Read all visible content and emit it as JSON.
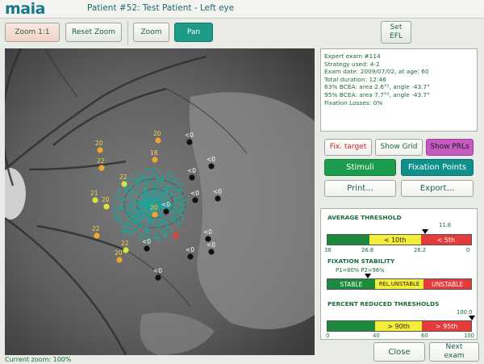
{
  "app": {
    "logo": "maia",
    "title": "Patient #52: Test Patient - Left eye"
  },
  "toolbar": {
    "zoom11": "Zoom 1:1",
    "reset_zoom": "Reset Zoom",
    "zoom": "Zoom",
    "pan": "Pan",
    "set_efl_1": "Set",
    "set_efl_2": "EFL"
  },
  "exam": {
    "line1": "Expert exam #114",
    "line2": "Strategy used: 4-2",
    "line3": "Exam date: 2009/07/02, at age: 60",
    "line4": "Total duration: 12:46",
    "line5": "63% BCEA: area 2.6°², angle -43.7°",
    "line6": "95% BCEA: area 7.7°², angle -43.7°",
    "line7": "Fixation Losses: 0%"
  },
  "controls": {
    "fix_target": "Fix. target",
    "show_grid": "Show Grid",
    "show_prls": "Show PRLs",
    "stimuli": "Stimuli",
    "fixation_points": "Fixation Points",
    "print": "Print...",
    "export": "Export..."
  },
  "threshold": {
    "title": "AVERAGE THRESHOLD",
    "value_label": "11.6",
    "value": 11.6,
    "seg1": "",
    "seg2": "< 10th",
    "seg3": "< 5th",
    "t36": "36",
    "t268": "26.8",
    "t262": "26.2",
    "t0": "0"
  },
  "stability": {
    "title": "FIXATION STABILITY",
    "p_text": "P1=80% P2=96%",
    "stable": "STABLE",
    "rel_unstable": "REL.UNSTABLE",
    "unstable": "UNSTABLE"
  },
  "reduced": {
    "title": "PERCENT REDUCED THRESHOLDS",
    "value_label": "100.0",
    "value": 100.0,
    "seg1": "",
    "seg2": "> 90th",
    "seg3": "> 95th",
    "t0": "0",
    "t40": "40",
    "t60": "60",
    "t100": "100"
  },
  "footer": {
    "close": "Close",
    "next1": "Next",
    "next2": "exam",
    "zoom_status": "Current zoom: 100%"
  },
  "colors": {
    "accent": "#1d9b86",
    "stable": "#1c8a3a",
    "warning": "#f4ee3a",
    "danger": "#e63b3b"
  },
  "stimuli_labels": [
    {
      "t": "20",
      "c": "orange"
    },
    {
      "t": "20",
      "c": "orange"
    },
    {
      "t": "<0",
      "c": "black"
    },
    {
      "t": "22",
      "c": "orange"
    },
    {
      "t": "18",
      "c": "orange"
    },
    {
      "t": "<0",
      "c": "black"
    },
    {
      "t": "22",
      "c": "yellow"
    },
    {
      "t": "<0",
      "c": "black"
    },
    {
      "t": "21",
      "c": "yellow"
    },
    {
      "t": "20",
      "c": "yellow"
    },
    {
      "t": "<0",
      "c": "black"
    },
    {
      "t": "<0",
      "c": "black"
    },
    {
      "t": "<0",
      "c": "black"
    },
    {
      "t": "20",
      "c": "orange"
    },
    {
      "t": "8",
      "c": "red"
    },
    {
      "t": "<0",
      "c": "black"
    },
    {
      "t": "22",
      "c": "yellow"
    },
    {
      "t": "<0",
      "c": "black"
    },
    {
      "t": "<0",
      "c": "black"
    },
    {
      "t": "<0",
      "c": "black"
    },
    {
      "t": "<0",
      "c": "black"
    },
    {
      "t": "22",
      "c": "orange"
    },
    {
      "t": "20",
      "c": "orange"
    }
  ]
}
